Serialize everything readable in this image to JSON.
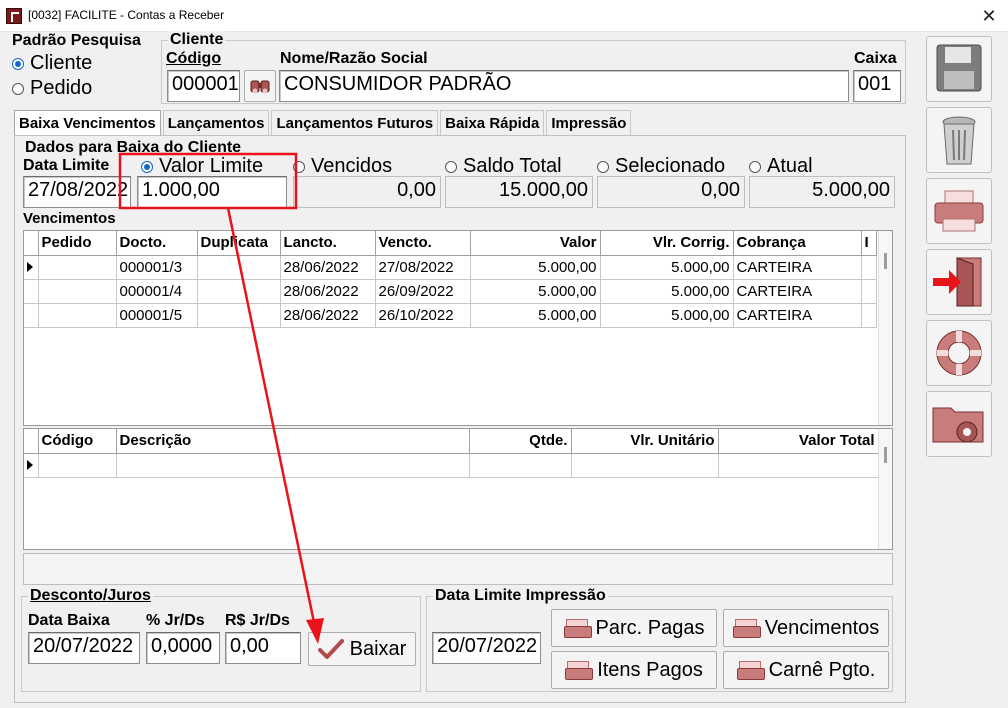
{
  "window": {
    "title": "[0032] FACILITE - Contas a Receber",
    "close_glyph": "✕"
  },
  "search": {
    "group_label": "Padrão Pesquisa",
    "options": [
      "Cliente",
      "Pedido"
    ],
    "selected": "Cliente"
  },
  "cliente": {
    "group_label": "Cliente",
    "codigo_label": "Código",
    "codigo_value": "000001",
    "nome_label": "Nome/Razão Social",
    "nome_value": "CONSUMIDOR PADRÃO",
    "caixa_label": "Caixa",
    "caixa_value": "001"
  },
  "tabs": [
    "Baixa Vencimentos",
    "Lançamentos",
    "Lançamentos Futuros",
    "Baixa Rápida",
    "Impressão"
  ],
  "active_tab": "Baixa Vencimentos",
  "dados": {
    "section_label": "Dados para Baixa do Cliente",
    "data_limite_label": "Data Limite",
    "data_limite_value": "27/08/2022",
    "options": [
      {
        "label": "Valor Limite",
        "value": "1.000,00",
        "selected": true
      },
      {
        "label": "Vencidos",
        "value": "0,00",
        "selected": false
      },
      {
        "label": "Saldo Total",
        "value": "15.000,00",
        "selected": false
      },
      {
        "label": "Selecionado",
        "value": "0,00",
        "selected": false
      },
      {
        "label": "Atual",
        "value": "5.000,00",
        "selected": false
      }
    ]
  },
  "vencimentos": {
    "section_label": "Vencimentos",
    "columns": [
      "Pedido",
      "Docto.",
      "Duplicata",
      "Lancto.",
      "Vencto.",
      "Valor",
      "Vlr. Corrig.",
      "Cobrança",
      "I"
    ],
    "rows": [
      {
        "pedido": "",
        "docto": "000001/3",
        "duplicata": "",
        "lancto": "28/06/2022",
        "vencto": "27/08/2022",
        "valor": "5.000,00",
        "corrig": "5.000,00",
        "cobranca": "CARTEIRA"
      },
      {
        "pedido": "",
        "docto": "000001/4",
        "duplicata": "",
        "lancto": "28/06/2022",
        "vencto": "26/09/2022",
        "valor": "5.000,00",
        "corrig": "5.000,00",
        "cobranca": "CARTEIRA"
      },
      {
        "pedido": "",
        "docto": "000001/5",
        "duplicata": "",
        "lancto": "28/06/2022",
        "vencto": "26/10/2022",
        "valor": "5.000,00",
        "corrig": "5.000,00",
        "cobranca": "CARTEIRA"
      }
    ]
  },
  "itens": {
    "columns": [
      "Código",
      "Descrição",
      "Qtde.",
      "Vlr. Unitário",
      "Valor Total"
    ]
  },
  "desconto": {
    "group_label": "Desconto/Juros",
    "data_baixa_label": "Data Baixa",
    "data_baixa_value": "20/07/2022",
    "jr_pct_label": "% Jr/Ds",
    "jr_pct_value": "0,0000",
    "jr_rs_label": "R$ Jr/Ds",
    "jr_rs_value": "0,00",
    "baixar_label": "Baixar"
  },
  "impressao": {
    "group_label": "Data Limite Impressão",
    "date_value": "20/07/2022",
    "buttons": [
      "Parc. Pagas",
      "Vencimentos",
      "Itens Pagos",
      "Carnê Pgto."
    ]
  },
  "sidebar": [
    "save-icon",
    "trash-icon",
    "printer-icon",
    "exit-door-icon",
    "lifebuoy-icon",
    "folder-gear-icon"
  ],
  "colors": {
    "annotation_red": "#e8141a",
    "accent_blue": "#1467c8",
    "icon_rose": "#c97c7c"
  }
}
